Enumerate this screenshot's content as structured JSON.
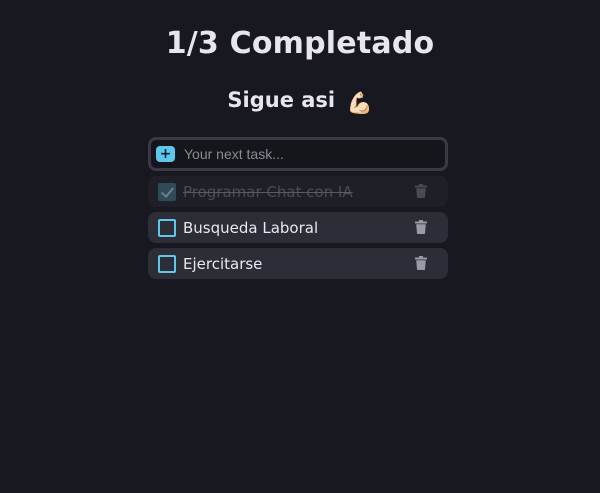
{
  "header": {
    "title": "1/3 Completado",
    "subtitle": "Sigue asi",
    "subtitle_emoji": "💪🏻"
  },
  "add_task": {
    "button_label": "+",
    "placeholder": "Your next task...",
    "value": ""
  },
  "tasks": [
    {
      "label": "Programar Chat con IA",
      "completed": true
    },
    {
      "label": "Busqueda Laboral",
      "completed": false
    },
    {
      "label": "Ejercitarse",
      "completed": false
    }
  ],
  "icons": {
    "add": "plus-icon",
    "delete": "trash-icon"
  },
  "colors": {
    "background": "#181820",
    "accent": "#5dc8ee",
    "task_bg": "#2d2d38",
    "task_done_bg": "#1f1f28"
  }
}
